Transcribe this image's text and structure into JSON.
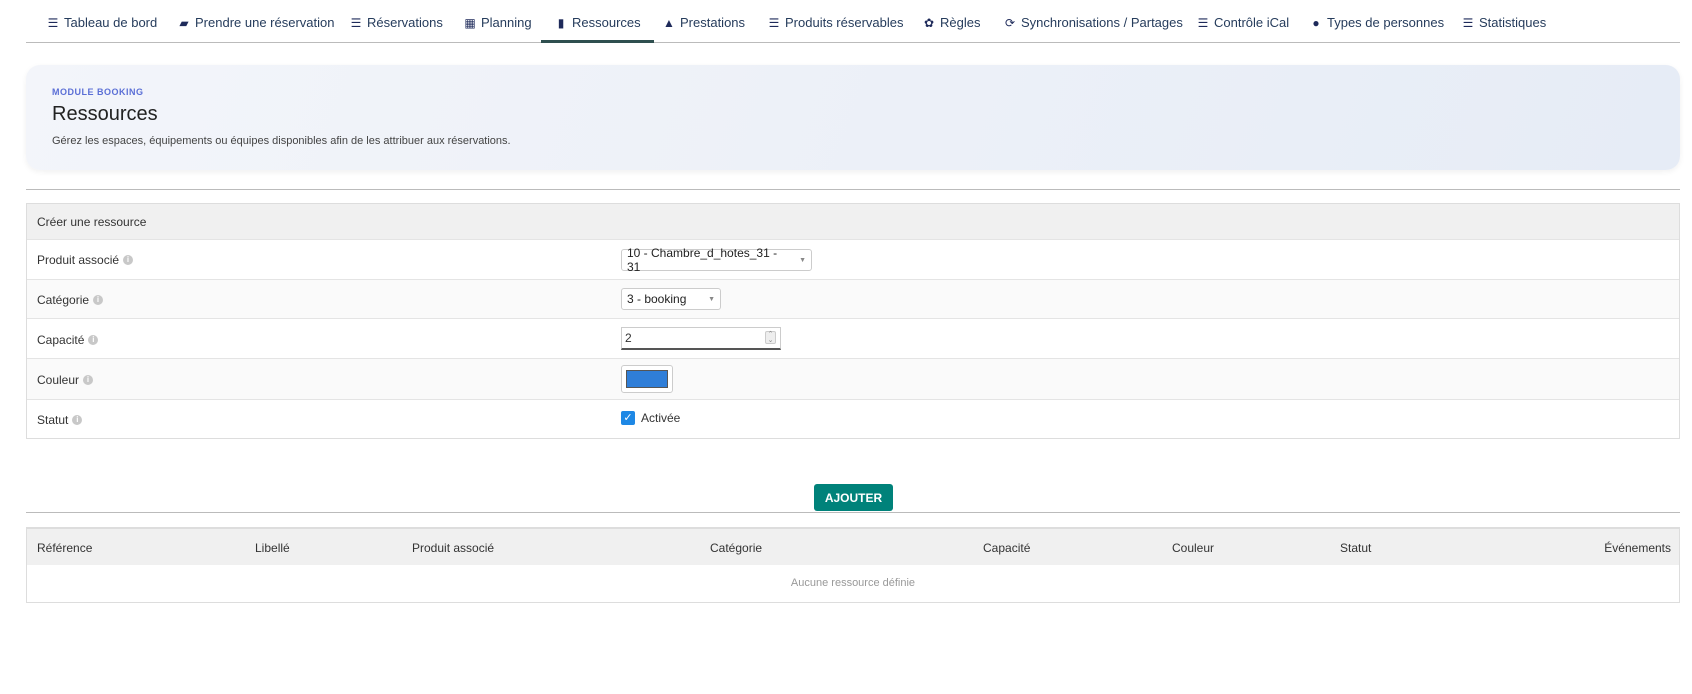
{
  "nav": {
    "items": [
      {
        "label": "Tableau de bord",
        "icon": "list-icon"
      },
      {
        "label": "Prendre une réservation",
        "icon": "bed-icon"
      },
      {
        "label": "Réservations",
        "icon": "list-icon"
      },
      {
        "label": "Planning",
        "icon": "calendar-icon"
      },
      {
        "label": "Ressources",
        "icon": "book-icon"
      },
      {
        "label": "Prestations",
        "icon": "bell-icon"
      },
      {
        "label": "Produits réservables",
        "icon": "list-icon"
      },
      {
        "label": "Règles",
        "icon": "gear-icon"
      },
      {
        "label": "Synchronisations / Partages",
        "icon": "sync-icon"
      },
      {
        "label": "Contrôle iCal",
        "icon": "sliders-icon"
      },
      {
        "label": "Types de personnes",
        "icon": "user-icon"
      },
      {
        "label": "Statistiques",
        "icon": "list-icon"
      }
    ],
    "active": "Ressources"
  },
  "hero": {
    "kicker": "MODULE BOOKING",
    "title": "Ressources",
    "description": "Gérez les espaces, équipements ou équipes disponibles afin de les attribuer aux réservations."
  },
  "form": {
    "title": "Créer une ressource",
    "fields": {
      "product": {
        "label": "Produit associé",
        "value": "10 - Chambre_d_hotes_31 - 31"
      },
      "category": {
        "label": "Catégorie",
        "value": "3 - booking"
      },
      "capacity": {
        "label": "Capacité",
        "value": "2"
      },
      "color": {
        "label": "Couleur",
        "value": "#2f7ed8"
      },
      "status": {
        "label": "Statut",
        "checkbox_label": "Activée",
        "checked": true
      }
    },
    "submit_label": "AJOUTER"
  },
  "table": {
    "columns": [
      "Référence",
      "Libellé",
      "Produit associé",
      "Catégorie",
      "Capacité",
      "Couleur",
      "Statut",
      "Événements"
    ],
    "empty_text": "Aucune ressource définie"
  }
}
